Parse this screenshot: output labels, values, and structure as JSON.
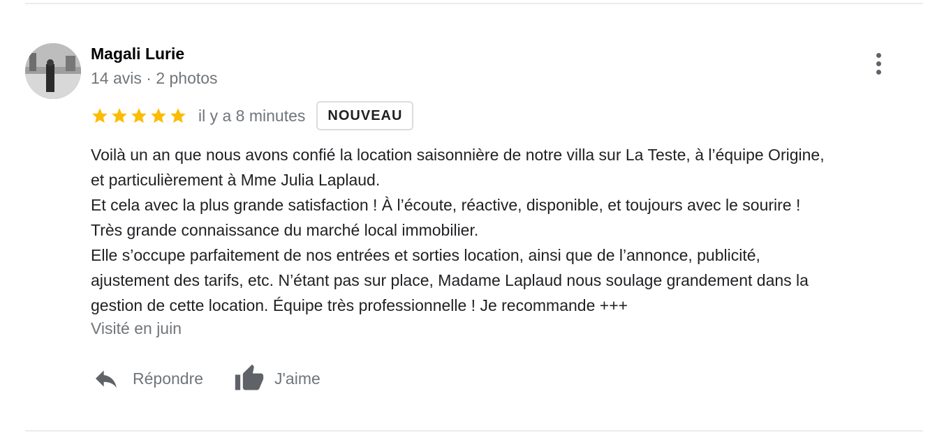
{
  "review": {
    "author": "Magali Lurie",
    "author_meta": "14 avis · 2 photos",
    "rating": 5,
    "rating_max": 5,
    "time": "il y a 8 minutes",
    "badge": "NOUVEAU",
    "body_lines": [
      "Voilà un an que nous avons confié la location saisonnière de notre villa sur La Teste, à l’équipe Origine,",
      "et particulièrement à Mme Julia Laplaud.",
      "Et cela avec la plus grande satisfaction ! À l’écoute, réactive, disponible, et toujours avec le sourire !",
      "Très grande connaissance du marché local immobilier.",
      "Elle s’occupe parfaitement de nos entrées et sorties location, ainsi que de l’annonce, publicité,",
      "ajustement des tarifs, etc. N’étant pas sur place, Madame Laplaud nous soulage grandement dans la",
      "gestion de cette location. Équipe très professionnelle ! Je recommande +++"
    ],
    "visited": "Visité en juin"
  },
  "actions": {
    "reply_label": "Répondre",
    "like_label": "J'aime"
  },
  "icons": {
    "avatar": "avatar-photo",
    "more": "more-vert-icon",
    "star": "star-icon",
    "reply": "reply-arrow-icon",
    "like": "thumb-up-icon"
  },
  "colors": {
    "star": "#fbbc04",
    "secondary_text": "#70757a",
    "icon": "#5f6368",
    "badge_border": "#dadce0",
    "divider": "#ebebeb"
  }
}
